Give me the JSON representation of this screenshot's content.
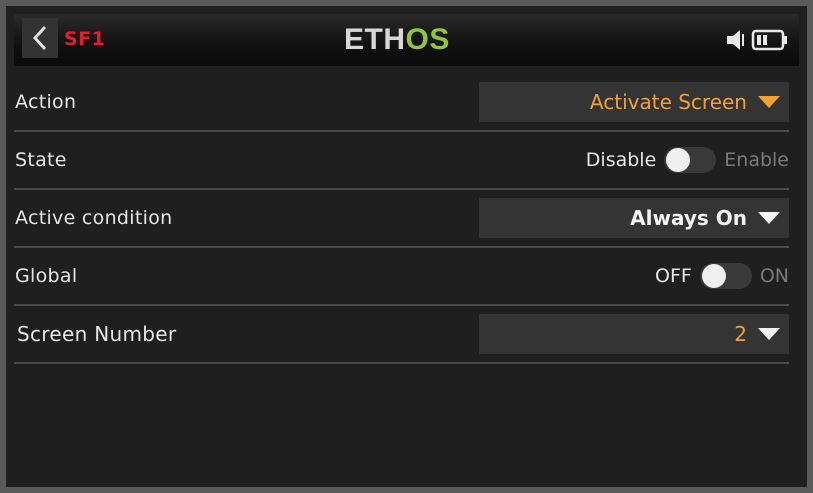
{
  "header": {
    "function_label": "SF1",
    "logo_prefix": "ETH",
    "logo_suffix": "OS",
    "accent_color": "#8ec63f",
    "function_color": "#e0202a"
  },
  "rows": {
    "action": {
      "label": "Action",
      "value": "Activate Screen"
    },
    "state": {
      "label": "State",
      "off_label": "Disable",
      "on_label": "Enable"
    },
    "active_condition": {
      "label": "Active condition",
      "value": "Always On"
    },
    "global": {
      "label": "Global",
      "off_label": "OFF",
      "on_label": "ON"
    },
    "screen_number": {
      "label": "Screen Number",
      "value": "2"
    }
  },
  "colors": {
    "value_orange": "#f3a133"
  }
}
